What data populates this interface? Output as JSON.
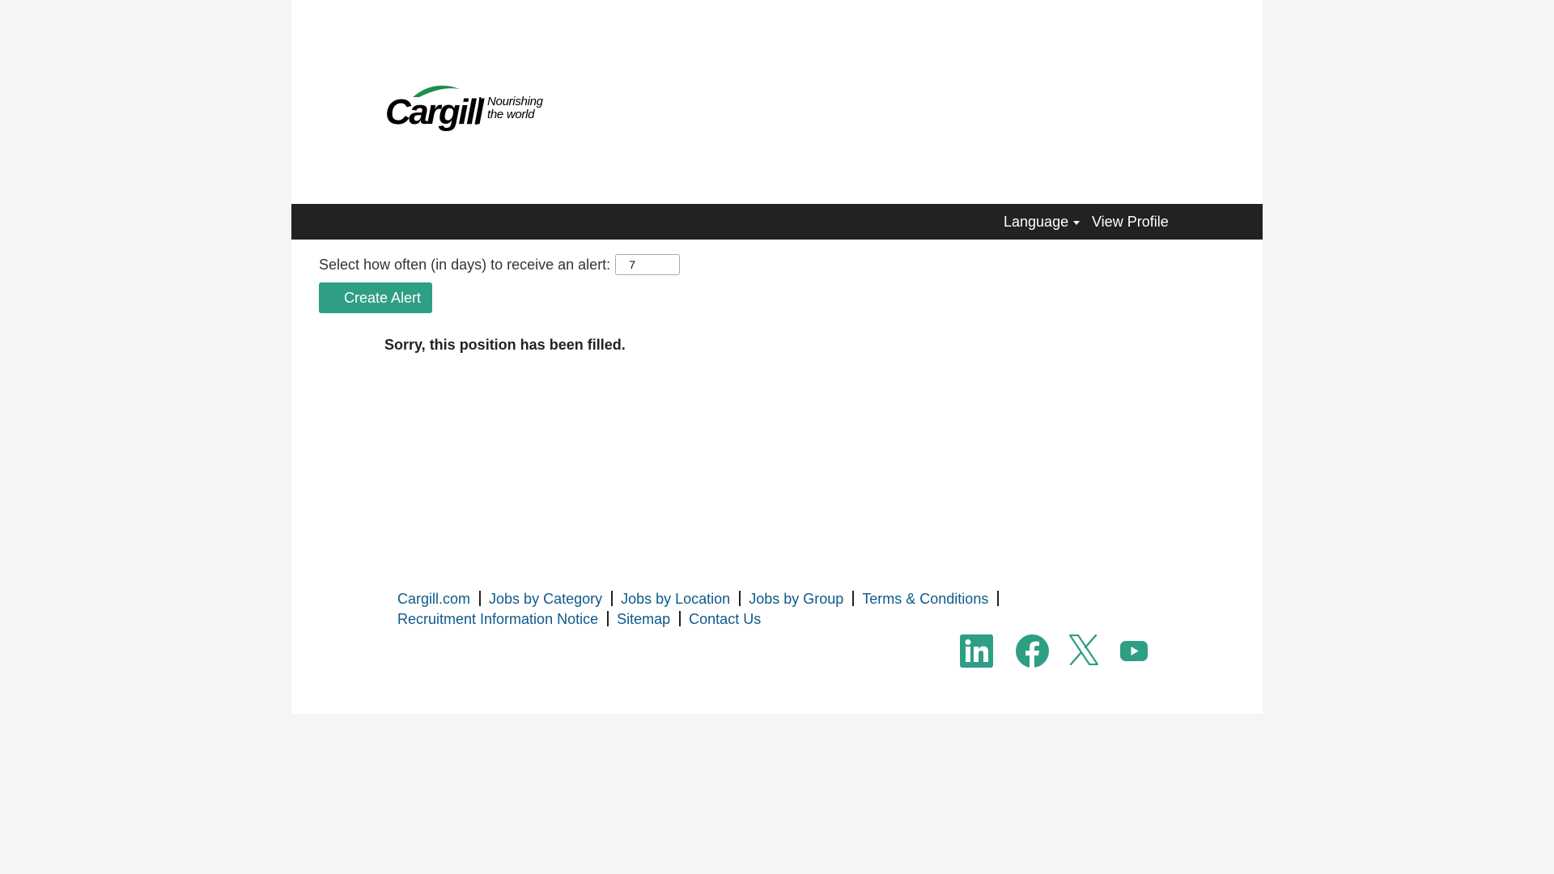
{
  "logo": {
    "wordmark": "Cargill",
    "tagline_line1": "Nourishing",
    "tagline_line2": "the world"
  },
  "nav": {
    "language_label": "Language",
    "profile_label": "View Profile"
  },
  "alert": {
    "prompt": "Select how often (in days) to receive an alert:",
    "days_value": "7",
    "button_label": "Create Alert"
  },
  "message": "Sorry, this position has been filled.",
  "footer": {
    "links": [
      "Cargill.com",
      "Jobs by Category",
      "Jobs by Location",
      "Jobs by Group",
      "Terms & Conditions",
      "Recruitment Information Notice",
      "Sitemap",
      "Contact Us"
    ]
  },
  "social": [
    "linkedin-icon",
    "facebook-icon",
    "x-icon",
    "youtube-icon"
  ],
  "colors": {
    "accent": "#2e9e85",
    "link": "#0e5a8a",
    "navbar": "#222222",
    "logo_leaf": "#1e8e4a"
  }
}
